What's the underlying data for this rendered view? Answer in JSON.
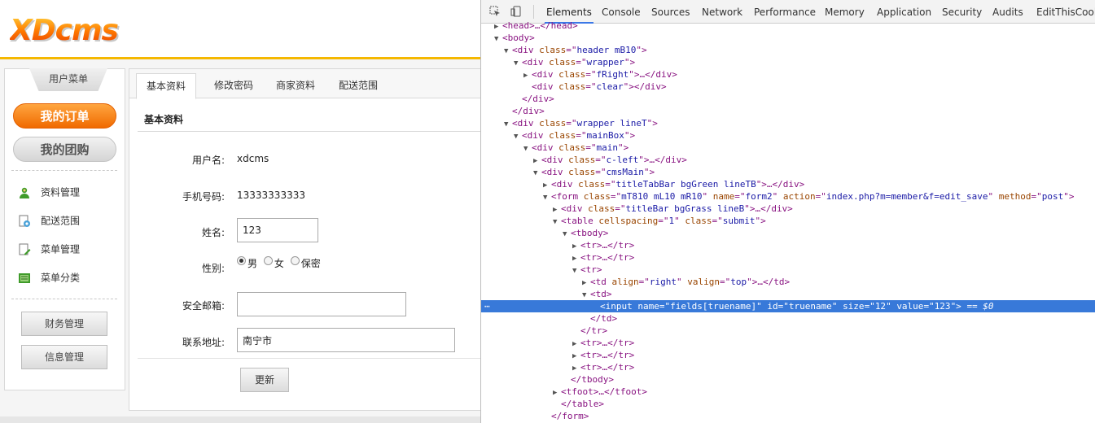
{
  "site": {
    "logo_text": "XDcms"
  },
  "sidebar": {
    "menu_title": "用户菜单",
    "primary_button": "我的订单",
    "secondary_button": "我的团购",
    "items": [
      {
        "label": "资料管理",
        "icon": "user-icon"
      },
      {
        "label": "配送范围",
        "icon": "delivery-icon"
      },
      {
        "label": "菜单管理",
        "icon": "menu-edit-icon"
      },
      {
        "label": "菜单分类",
        "icon": "category-icon"
      }
    ],
    "bottom_buttons": [
      "财务管理",
      "信息管理"
    ]
  },
  "main": {
    "tabs": [
      "基本资料",
      "修改密码",
      "商家资料",
      "配送范围"
    ],
    "active_tab": 0,
    "section_title": "基本资料",
    "form": {
      "username_label": "用户名:",
      "username_value": "xdcms",
      "phone_label": "手机号码:",
      "phone_value": "13333333333",
      "name_label": "姓名:",
      "name_value": "123",
      "gender_label": "性别:",
      "gender_options": [
        "男",
        "女",
        "保密"
      ],
      "gender_selected": 0,
      "email_label": "安全邮箱:",
      "email_value": "",
      "address_label": "联系地址:",
      "address_value": "南宁市"
    },
    "submit_label": "更新"
  },
  "devtools": {
    "tabs": [
      "Elements",
      "Console",
      "Sources",
      "Network",
      "Performance",
      "Memory",
      "Application",
      "Security",
      "Audits",
      "EditThisCookie"
    ],
    "active_tab": "Elements",
    "lines": [
      {
        "indent": 1,
        "tri": "right",
        "html": "<span>&lt;head&gt;…&lt;/head&gt;</span>"
      },
      {
        "indent": 1,
        "tri": "down",
        "html": "<span>&lt;body&gt;</span>"
      },
      {
        "indent": 2,
        "tri": "down",
        "html": "&lt;div <span class=an>class</span>=\"<span class=av>header mB10</span>\"&gt;"
      },
      {
        "indent": 3,
        "tri": "down",
        "html": "&lt;div <span class=an>class</span>=\"<span class=av>wrapper</span>\"&gt;"
      },
      {
        "indent": 4,
        "tri": "right",
        "html": "&lt;div <span class=an>class</span>=\"<span class=av>fRight</span>\"&gt;…&lt;/div&gt;"
      },
      {
        "indent": 4,
        "tri": "none",
        "html": "&lt;div <span class=an>class</span>=\"<span class=av>clear</span>\"&gt;&lt;/div&gt;"
      },
      {
        "indent": 3,
        "tri": "none",
        "html": "&lt;/div&gt;"
      },
      {
        "indent": 2,
        "tri": "none",
        "html": "&lt;/div&gt;"
      },
      {
        "indent": 2,
        "tri": "down",
        "html": "&lt;div <span class=an>class</span>=\"<span class=av>wrapper lineT</span>\"&gt;"
      },
      {
        "indent": 3,
        "tri": "down",
        "html": "&lt;div <span class=an>class</span>=\"<span class=av>mainBox</span>\"&gt;"
      },
      {
        "indent": 4,
        "tri": "down",
        "html": "&lt;div <span class=an>class</span>=\"<span class=av>main</span>\"&gt;"
      },
      {
        "indent": 5,
        "tri": "right",
        "html": "&lt;div <span class=an>class</span>=\"<span class=av>c-left</span>\"&gt;…&lt;/div&gt;"
      },
      {
        "indent": 5,
        "tri": "down",
        "html": "&lt;div <span class=an>class</span>=\"<span class=av>cmsMain</span>\"&gt;"
      },
      {
        "indent": 6,
        "tri": "right",
        "html": "&lt;div <span class=an>class</span>=\"<span class=av>titleTabBar bgGreen lineTB</span>\"&gt;…&lt;/div&gt;"
      },
      {
        "indent": 6,
        "tri": "down",
        "html": "&lt;form <span class=an>class</span>=\"<span class=av>mT810 mL10 mR10</span>\" <span class=an>name</span>=\"<span class=av>form2</span>\" <span class=an>action</span>=\"<span class=av>index.php?m=member&amp;f=edit_save</span>\" <span class=an>method</span>=\"<span class=av>post</span>\"&gt;"
      },
      {
        "indent": 7,
        "tri": "right",
        "html": "&lt;div <span class=an>class</span>=\"<span class=av>titleBar bgGrass lineB</span>\"&gt;…&lt;/div&gt;"
      },
      {
        "indent": 7,
        "tri": "down",
        "html": "&lt;table <span class=an>cellspacing</span>=\"<span class=av>1</span>\" <span class=an>class</span>=\"<span class=av>submit</span>\"&gt;"
      },
      {
        "indent": 8,
        "tri": "down",
        "html": "&lt;tbody&gt;"
      },
      {
        "indent": 9,
        "tri": "right",
        "html": "&lt;tr&gt;…&lt;/tr&gt;"
      },
      {
        "indent": 9,
        "tri": "right",
        "html": "&lt;tr&gt;…&lt;/tr&gt;"
      },
      {
        "indent": 9,
        "tri": "down",
        "html": "&lt;tr&gt;"
      },
      {
        "indent": 10,
        "tri": "right",
        "html": "&lt;td <span class=an>align</span>=\"<span class=av>right</span>\" <span class=an>valign</span>=\"<span class=av>top</span>\"&gt;…&lt;/td&gt;"
      },
      {
        "indent": 10,
        "tri": "down",
        "html": "&lt;td&gt;"
      },
      {
        "indent": 11,
        "tri": "none",
        "selected": true,
        "html": "&lt;input <span class=an>name</span>=\"<span class=av>fields[truename]</span>\" <span class=an>id</span>=\"<span class=av>truename</span>\" <span class=an>size</span>=\"<span class=av>12</span>\" <span class=an>value</span>=\"<span class=av>123</span>\"&gt; <span class=eq0>== $0</span>"
      },
      {
        "indent": 10,
        "tri": "none",
        "html": "&lt;/td&gt;"
      },
      {
        "indent": 9,
        "tri": "none",
        "html": "&lt;/tr&gt;"
      },
      {
        "indent": 9,
        "tri": "right",
        "html": "&lt;tr&gt;…&lt;/tr&gt;"
      },
      {
        "indent": 9,
        "tri": "right",
        "html": "&lt;tr&gt;…&lt;/tr&gt;"
      },
      {
        "indent": 9,
        "tri": "right",
        "html": "&lt;tr&gt;…&lt;/tr&gt;"
      },
      {
        "indent": 8,
        "tri": "none",
        "html": "&lt;/tbody&gt;"
      },
      {
        "indent": 7,
        "tri": "right",
        "html": "&lt;tfoot&gt;…&lt;/tfoot&gt;"
      },
      {
        "indent": 7,
        "tri": "none",
        "html": "&lt;/table&gt;"
      },
      {
        "indent": 6,
        "tri": "none",
        "html": "&lt;/form&gt;"
      }
    ]
  },
  "colors": {
    "accent_orange": "#f06a00",
    "header_line": "#f5b800",
    "devtools_selection": "#3879d9",
    "devtools_tab_underline": "#3b78e7"
  }
}
